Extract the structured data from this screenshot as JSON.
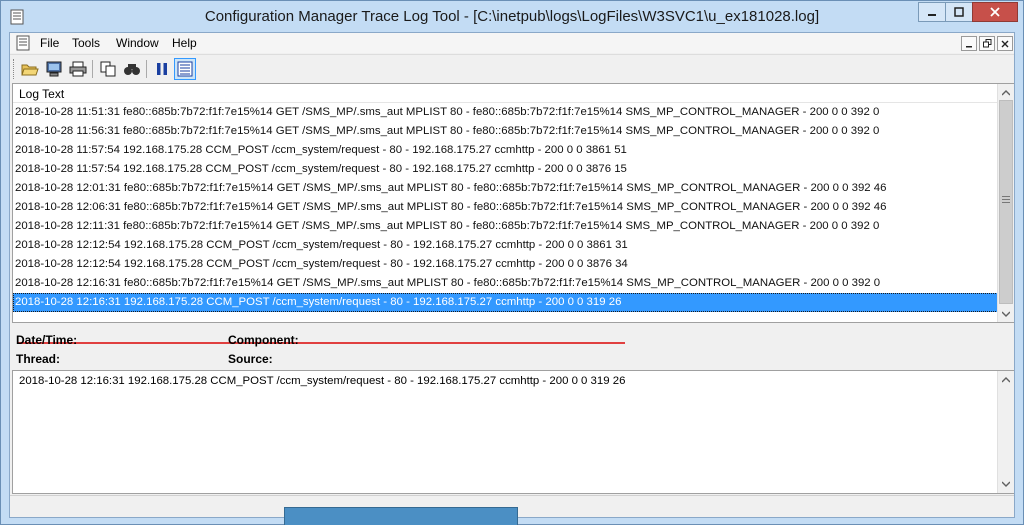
{
  "window": {
    "title": "Configuration Manager Trace Log Tool - [C:\\inetpub\\logs\\LogFiles\\W3SVC1\\u_ex181028.log]"
  },
  "menu": {
    "items": [
      "File",
      "Tools",
      "Window",
      "Help"
    ]
  },
  "toolbar": {
    "buttons": [
      "open-folder-icon",
      "computer-icon",
      "print-icon",
      "copy-icon",
      "find-icon",
      "pause-icon",
      "highlight-icon"
    ]
  },
  "log": {
    "header": "Log Text",
    "rows": [
      "2018-10-28 11:51:31 fe80::685b:7b72:f1f:7e15%14 GET /SMS_MP/.sms_aut MPLIST 80 - fe80::685b:7b72:f1f:7e15%14 SMS_MP_CONTROL_MANAGER - 200 0 0 392 0",
      "2018-10-28 11:56:31 fe80::685b:7b72:f1f:7e15%14 GET /SMS_MP/.sms_aut MPLIST 80 - fe80::685b:7b72:f1f:7e15%14 SMS_MP_CONTROL_MANAGER - 200 0 0 392 0",
      "2018-10-28 11:57:54 192.168.175.28 CCM_POST /ccm_system/request - 80 - 192.168.175.27 ccmhttp - 200 0 0 3861 51",
      "2018-10-28 11:57:54 192.168.175.28 CCM_POST /ccm_system/request - 80 - 192.168.175.27 ccmhttp - 200 0 0 3876 15",
      "2018-10-28 12:01:31 fe80::685b:7b72:f1f:7e15%14 GET /SMS_MP/.sms_aut MPLIST 80 - fe80::685b:7b72:f1f:7e15%14 SMS_MP_CONTROL_MANAGER - 200 0 0 392 46",
      "2018-10-28 12:06:31 fe80::685b:7b72:f1f:7e15%14 GET /SMS_MP/.sms_aut MPLIST 80 - fe80::685b:7b72:f1f:7e15%14 SMS_MP_CONTROL_MANAGER - 200 0 0 392 46",
      "2018-10-28 12:11:31 fe80::685b:7b72:f1f:7e15%14 GET /SMS_MP/.sms_aut MPLIST 80 - fe80::685b:7b72:f1f:7e15%14 SMS_MP_CONTROL_MANAGER - 200 0 0 392 0",
      "2018-10-28 12:12:54 192.168.175.28 CCM_POST /ccm_system/request - 80 - 192.168.175.27 ccmhttp - 200 0 0 3861 31",
      "2018-10-28 12:12:54 192.168.175.28 CCM_POST /ccm_system/request - 80 - 192.168.175.27 ccmhttp - 200 0 0 3876 34",
      "2018-10-28 12:16:31 fe80::685b:7b72:f1f:7e15%14 GET /SMS_MP/.sms_aut MPLIST 80 - fe80::685b:7b72:f1f:7e15%14 SMS_MP_CONTROL_MANAGER - 200 0 0 392 0",
      "2018-10-28 12:16:31 192.168.175.28 CCM_POST /ccm_system/request - 80 - 192.168.175.27 ccmhttp - 200 0 0 319 26"
    ],
    "selected_index": 10
  },
  "details": {
    "datetime_label": "Date/Time:",
    "component_label": "Component:",
    "thread_label": "Thread:",
    "source_label": "Source:",
    "text": "2018-10-28 12:16:31 192.168.175.28 CCM_POST /ccm_system/request - 80 - 192.168.175.27 ccmhttp - 200 0 0 319 26"
  },
  "colors": {
    "selection": "#3399ff",
    "underline": "#e04040",
    "close_button": "#c7504a"
  }
}
